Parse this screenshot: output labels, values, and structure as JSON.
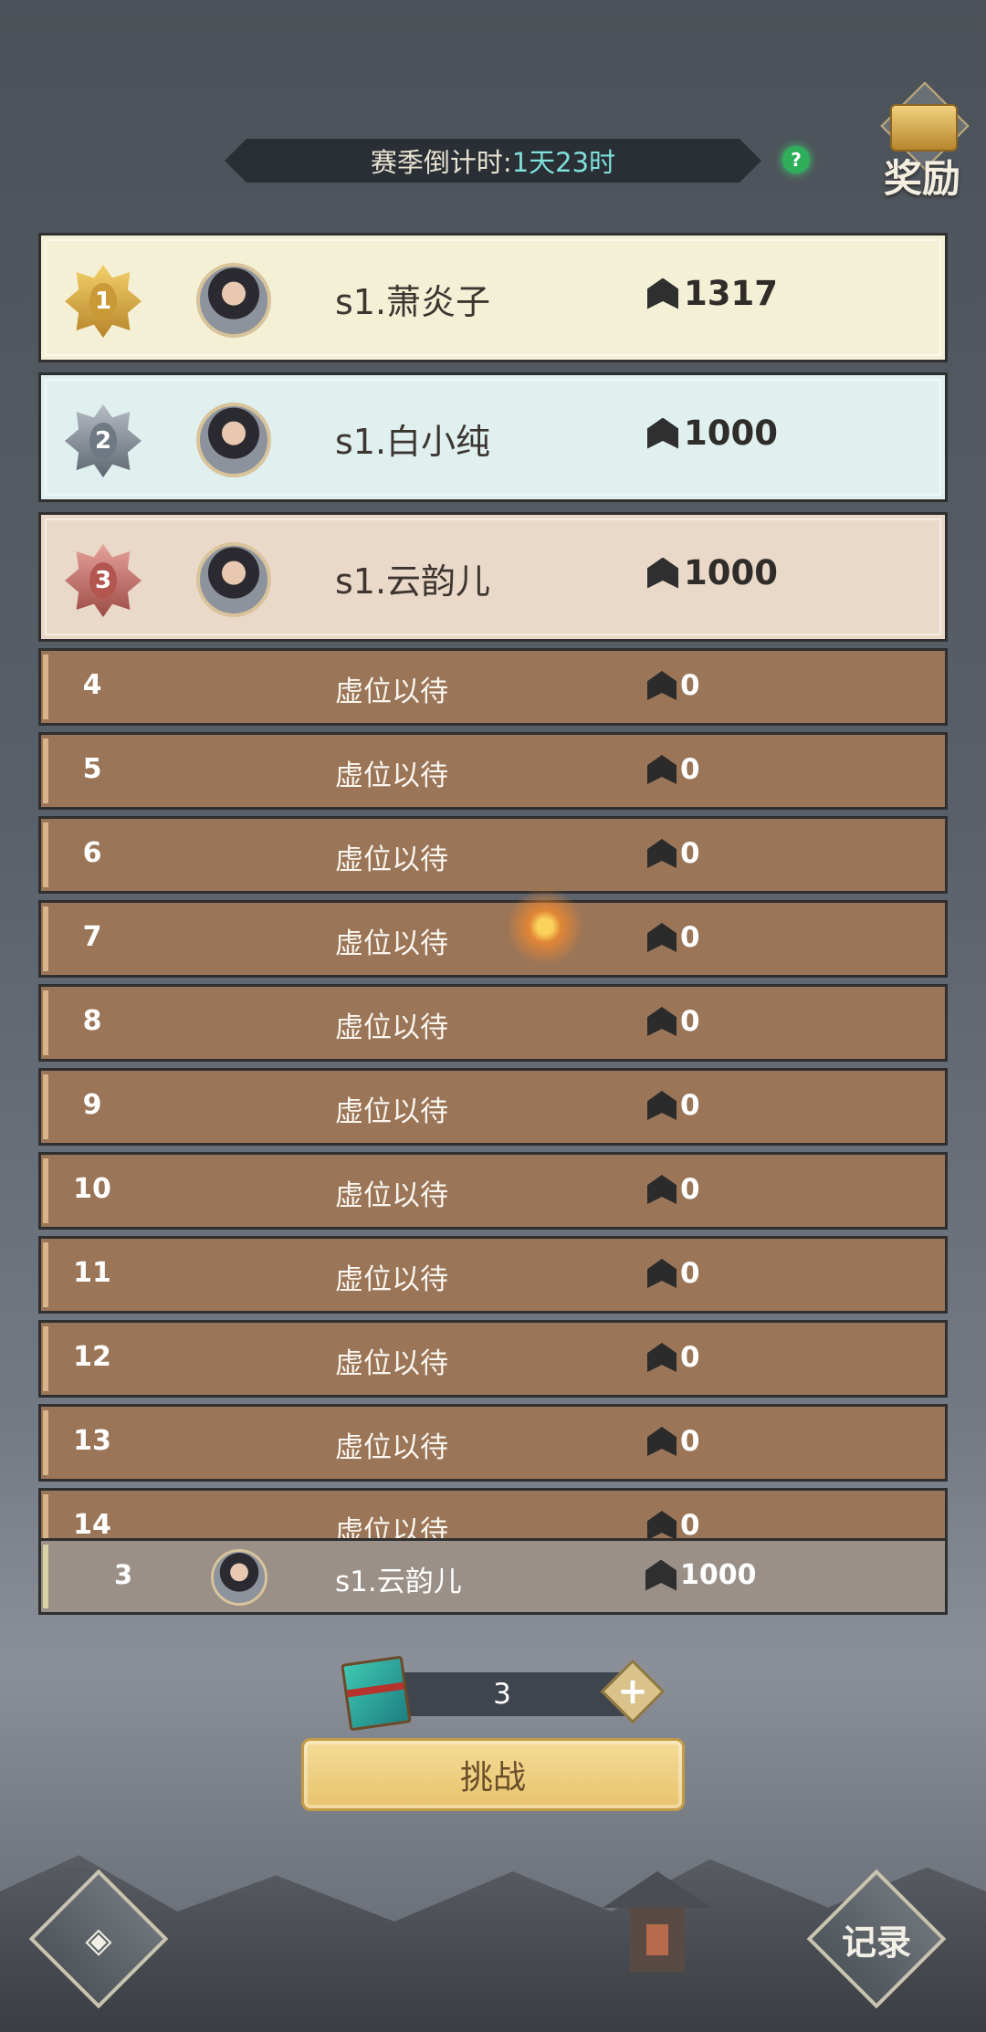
{
  "header": {
    "countdown_label": "赛季倒计时:",
    "countdown_value": "1天23时",
    "help_icon": "?",
    "reward_label": "奖励"
  },
  "top3": [
    {
      "rank": "1",
      "name": "s1.萧炎子",
      "score": "1317"
    },
    {
      "rank": "2",
      "name": "s1.白小纯",
      "score": "1000"
    },
    {
      "rank": "3",
      "name": "s1.云韵儿",
      "score": "1000"
    }
  ],
  "rows": [
    {
      "rank": "4",
      "name": "虚位以待",
      "score": "0"
    },
    {
      "rank": "5",
      "name": "虚位以待",
      "score": "0"
    },
    {
      "rank": "6",
      "name": "虚位以待",
      "score": "0"
    },
    {
      "rank": "7",
      "name": "虚位以待",
      "score": "0"
    },
    {
      "rank": "8",
      "name": "虚位以待",
      "score": "0"
    },
    {
      "rank": "9",
      "name": "虚位以待",
      "score": "0"
    },
    {
      "rank": "10",
      "name": "虚位以待",
      "score": "0"
    },
    {
      "rank": "11",
      "name": "虚位以待",
      "score": "0"
    },
    {
      "rank": "12",
      "name": "虚位以待",
      "score": "0"
    },
    {
      "rank": "13",
      "name": "虚位以待",
      "score": "0"
    },
    {
      "rank": "14",
      "name": "虚位以待",
      "score": "0"
    }
  ],
  "my_rank": {
    "rank": "3",
    "name": "s1.云韵儿",
    "score": "1000"
  },
  "tickets": {
    "count": "3",
    "add_icon": "+"
  },
  "challenge_label": "挑战",
  "record_label": "记录",
  "colors": {
    "accent": "#7fe0dc",
    "row_brown": "#9a7558",
    "button_gold": "#f4dc98"
  }
}
